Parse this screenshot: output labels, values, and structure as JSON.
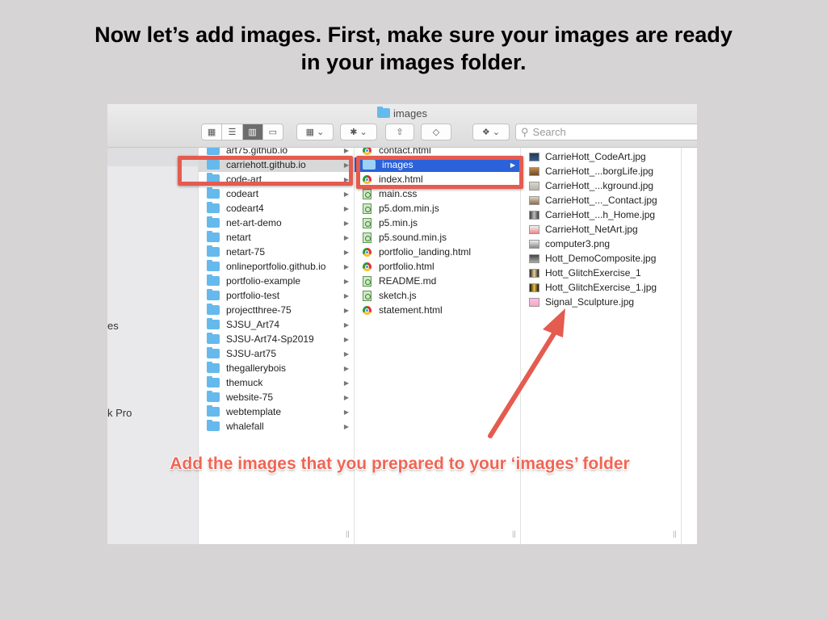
{
  "slide": {
    "title": "Now let’s add images. First, make sure your images are ready\nin your images folder.",
    "callout": "Add the images that you prepared to your ‘images’ folder"
  },
  "finder": {
    "window_title": "images",
    "search_placeholder": "Search",
    "sidebar_partial_labels": [
      "es",
      "k Pro"
    ]
  },
  "columns": {
    "repos": [
      {
        "label": "art75.github.io",
        "selected": false
      },
      {
        "label": "carriehott.github.io",
        "selected": true
      },
      {
        "label": "code-art",
        "selected": false
      },
      {
        "label": "codeart",
        "selected": false
      },
      {
        "label": "codeart4",
        "selected": false
      },
      {
        "label": "net-art-demo",
        "selected": false
      },
      {
        "label": "netart",
        "selected": false
      },
      {
        "label": "netart-75",
        "selected": false
      },
      {
        "label": "onlineportfolio.github.io",
        "selected": false
      },
      {
        "label": "portfolio-example",
        "selected": false
      },
      {
        "label": "portfolio-test",
        "selected": false
      },
      {
        "label": "projectthree-75",
        "selected": false
      },
      {
        "label": "SJSU_Art74",
        "selected": false
      },
      {
        "label": "SJSU-Art74-Sp2019",
        "selected": false
      },
      {
        "label": "SJSU-art75",
        "selected": false
      },
      {
        "label": "thegallerybois",
        "selected": false
      },
      {
        "label": "themuck",
        "selected": false
      },
      {
        "label": "website-75",
        "selected": false
      },
      {
        "label": "webtemplate",
        "selected": false
      },
      {
        "label": "whalefall",
        "selected": false
      }
    ],
    "site_files": [
      {
        "label": "contact.html",
        "kind": "html"
      },
      {
        "label": "images",
        "kind": "folder",
        "selected": true
      },
      {
        "label": "index.html",
        "kind": "html"
      },
      {
        "label": "main.css",
        "kind": "code"
      },
      {
        "label": "p5.dom.min.js",
        "kind": "code"
      },
      {
        "label": "p5.min.js",
        "kind": "code"
      },
      {
        "label": "p5.sound.min.js",
        "kind": "code"
      },
      {
        "label": "portfolio_landing.html",
        "kind": "html"
      },
      {
        "label": "portfolio.html",
        "kind": "html"
      },
      {
        "label": "README.md",
        "kind": "code"
      },
      {
        "label": "sketch.js",
        "kind": "code"
      },
      {
        "label": "statement.html",
        "kind": "html"
      }
    ],
    "images": [
      {
        "label": "CarrieHott_CodeArt.jpg",
        "thumb": "t-dark"
      },
      {
        "label": "CarrieHott_...borgLife.jpg",
        "thumb": "t-photo"
      },
      {
        "label": "CarrieHott_...kground.jpg",
        "thumb": "t-light"
      },
      {
        "label": "CarrieHott_..._Contact.jpg",
        "thumb": "t-brown"
      },
      {
        "label": "CarrieHott_...h_Home.jpg",
        "thumb": "t-portrait"
      },
      {
        "label": "CarrieHott_NetArt.jpg",
        "thumb": "t-red"
      },
      {
        "label": "computer3.png",
        "thumb": "t-screen"
      },
      {
        "label": "Hott_DemoComposite.jpg",
        "thumb": "t-comp"
      },
      {
        "label": "Hott_GlitchExercise_1",
        "thumb": "t-glitch"
      },
      {
        "label": "Hott_GlitchExercise_1.jpg",
        "thumb": "t-glitch2"
      },
      {
        "label": "Signal_Sculpture.jpg",
        "thumb": "t-signal"
      }
    ]
  },
  "colors": {
    "highlight_border": "#e45b4f",
    "selection_blue": "#2b62d9",
    "folder_blue": "#66b9ec",
    "arrow": "#e45b4f"
  }
}
